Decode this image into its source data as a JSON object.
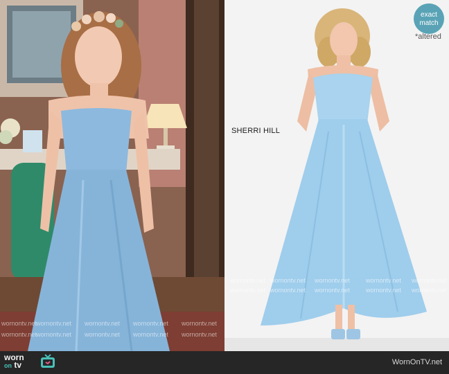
{
  "brand": "SHERRI HILL",
  "badge": {
    "line1": "exact",
    "line2": "match"
  },
  "altered": "*altered",
  "footer": {
    "logo_word": "worn",
    "logo_on": "on",
    "logo_tv": "tv",
    "site": "WornOnTV.net"
  },
  "watermark": "wornontv.net",
  "colors": {
    "badge": "#5aa3b6",
    "dress": "#8cbfe0",
    "footer": "#262626",
    "accent": "#49c0b8"
  }
}
